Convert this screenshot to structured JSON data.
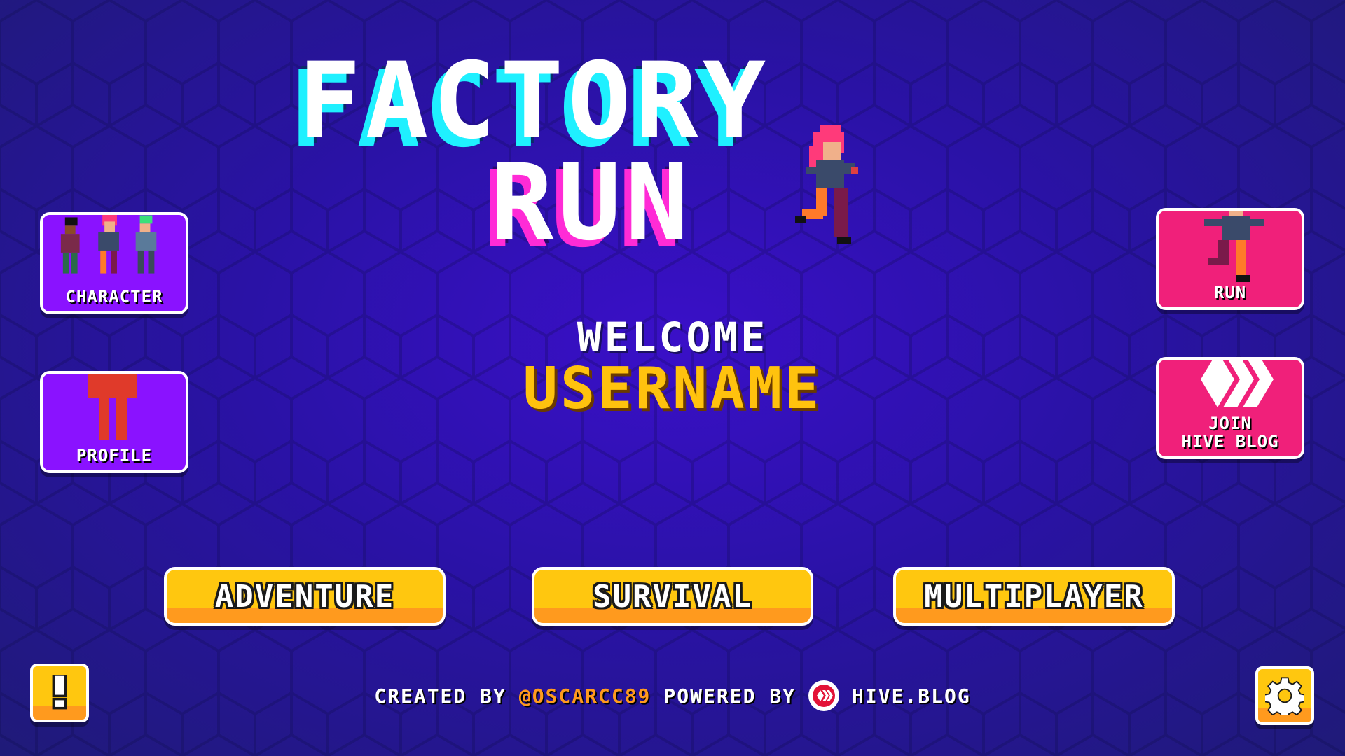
{
  "title": {
    "line1": "Factory",
    "line2": "Run"
  },
  "left_menu": {
    "character_label": "CHARACTER",
    "profile_label": "PROFILE"
  },
  "right_menu": {
    "run_label": "RUN",
    "join_label_line1": "JOIN",
    "join_label_line2": "HIVE BLOG"
  },
  "welcome": {
    "greeting": "WELCOME",
    "username": "USERNAME"
  },
  "modes": {
    "adventure": "ADVENTURE",
    "survival": "SURVIVAL",
    "multiplayer": "MULTIPLAYER"
  },
  "footer": {
    "created_by": "CREATED BY",
    "author": "@OSCARCC89",
    "powered_by": "POWERED BY",
    "platform": "HIVE.BLOG"
  },
  "icons": {
    "info": "exclamation-icon",
    "settings": "gear-icon",
    "hive": "hive-logo-icon"
  },
  "colors": {
    "background": "#2a12a6",
    "title_cyan_shadow": "#1ff0ff",
    "title_pink_shadow": "#ff2bd6",
    "username": "#ffc20e",
    "purple_button": "#8a12ff",
    "pink_button": "#f0207a",
    "mode_button": "#ffc70f",
    "author": "#ff9a1e"
  }
}
